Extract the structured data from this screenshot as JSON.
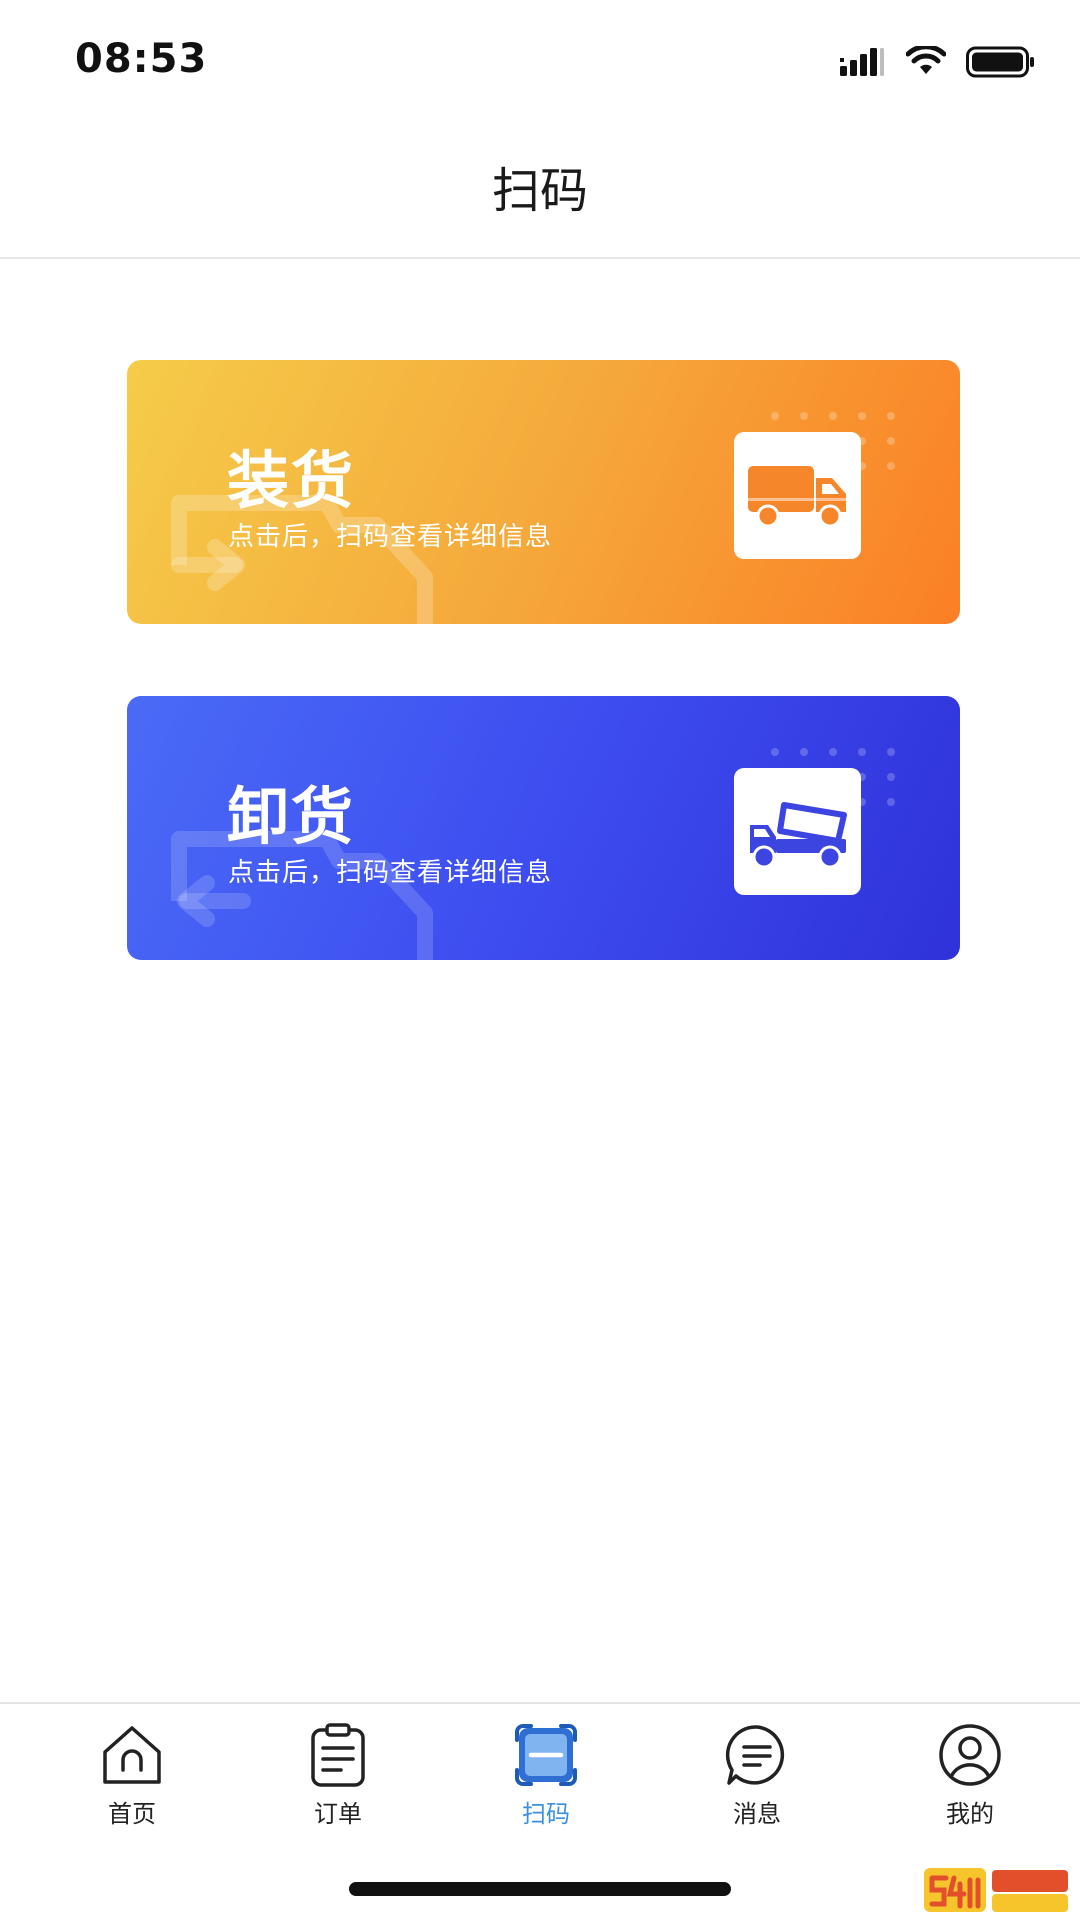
{
  "status_bar": {
    "time": "08:53"
  },
  "header": {
    "title": "扫码"
  },
  "cards": [
    {
      "title": "装货",
      "subtitle": "点击后，扫码查看详细信息",
      "icon": "loading-truck-icon",
      "color_start": "#f5cc4a",
      "color_end": "#fb7f25"
    },
    {
      "title": "卸货",
      "subtitle": "点击后，扫码查看详细信息",
      "icon": "dump-truck-icon",
      "color_start": "#4a6bf6",
      "color_end": "#2f31d9"
    }
  ],
  "tabs": [
    {
      "label": "首页",
      "icon": "home-icon",
      "active": false
    },
    {
      "label": "订单",
      "icon": "clipboard-icon",
      "active": false
    },
    {
      "label": "扫码",
      "icon": "scan-icon",
      "active": true
    },
    {
      "label": "消息",
      "icon": "message-icon",
      "active": false
    },
    {
      "label": "我的",
      "icon": "profile-icon",
      "active": false
    }
  ],
  "colors": {
    "active_tab": "#3d8fe0",
    "load_truck": "#f5872a",
    "unload_truck": "#3d45e0"
  }
}
